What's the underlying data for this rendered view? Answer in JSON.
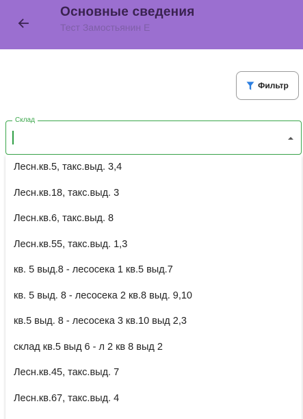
{
  "header": {
    "title": "Основные сведения",
    "subtitle": "Тест Замостьянин Е",
    "back_icon": "arrow-left-icon",
    "background_color": "#9b6fd0"
  },
  "toolbar": {
    "filter_label": "Фильтр",
    "filter_icon": "funnel-icon",
    "filter_icon_color": "#2d7fe0"
  },
  "warehouse_field": {
    "label": "Склад",
    "value": "",
    "accent_color": "#3aa64a",
    "arrow_icon": "dropdown-arrow-icon"
  },
  "options": [
    "Лесн.кв.5, такс.выд. 3,4",
    "Лесн.кв.18, такс.выд. 3",
    "Лесн.кв.6, такс.выд. 8",
    "Лесн.кв.55, такс.выд. 1,3",
    "кв. 5 выд.8 - лесосека 1 кв.5 выд.7",
    "кв. 5 выд. 8 - лесосека 2 кв.8 выд. 9,10",
    "кв.5 выд. 8 - лесосека 3 кв.10 выд 2,3",
    "склад кв.5 выд 6 - л 2 кв 8 выд 2",
    "Лесн.кв.45, такс.выд. 7",
    "Лесн.кв.67, такс.выд. 4"
  ]
}
